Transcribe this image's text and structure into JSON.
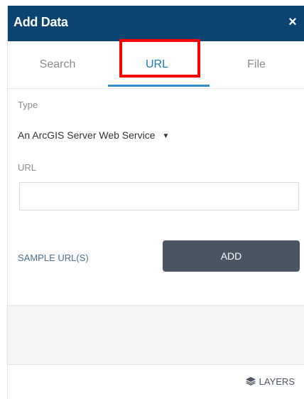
{
  "header": {
    "title": "Add Data",
    "close_icon": "close-icon",
    "close_glyph": "×"
  },
  "tabs": [
    {
      "label": "Search",
      "active": false
    },
    {
      "label": "URL",
      "active": true
    },
    {
      "label": "File",
      "active": false
    }
  ],
  "form": {
    "type_label": "Type",
    "type_value": "An ArcGIS Server Web Service",
    "url_label": "URL",
    "url_value": "",
    "sample_label": "SAMPLE URL(S)",
    "add_label": "ADD"
  },
  "footer": {
    "layers_label": "LAYERS",
    "layers_icon": "layers-icon"
  },
  "colors": {
    "header_bg": "#0c4471",
    "active_tab": "#1a7bb5",
    "tab_underline": "#2f8ecb",
    "highlight": "#ff0000",
    "add_button": "#4a5563"
  }
}
